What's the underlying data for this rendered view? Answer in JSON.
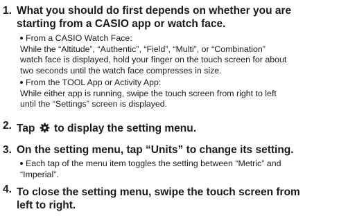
{
  "steps": [
    {
      "number": "1.",
      "lines": [
        "What you should do first depends on whether you are",
        "starting from a CASIO app or watch face."
      ],
      "bullets": [
        {
          "lines": [
            "From a CASIO Watch Face:",
            "While the “Altitude”, “Authentic”, “Field”, “Multi”, or “Combination”",
            "watch face is displayed, hold your finger on the touch screen for about",
            "two seconds until the watch face compresses in size."
          ]
        },
        {
          "lines": [
            "From the TOOL App or Activity App:",
            "While either app is running, swipe the touch screen from right to left",
            "until the “Settings” screen is displayed."
          ]
        }
      ]
    },
    {
      "number": "2.",
      "before_icon": "Tap",
      "icon": "gear-icon",
      "after_icon": "to display the setting menu."
    },
    {
      "number": "3.",
      "lines": [
        "On the setting menu, tap “Units” to change its setting."
      ],
      "bullets": [
        {
          "lines": [
            "Each tap of the menu item toggles the setting between “Metric” and",
            "“Imperial”."
          ]
        }
      ]
    },
    {
      "number": "4.",
      "lines": [
        "To close the setting menu, swipe the touch screen from",
        "left to right."
      ]
    }
  ]
}
